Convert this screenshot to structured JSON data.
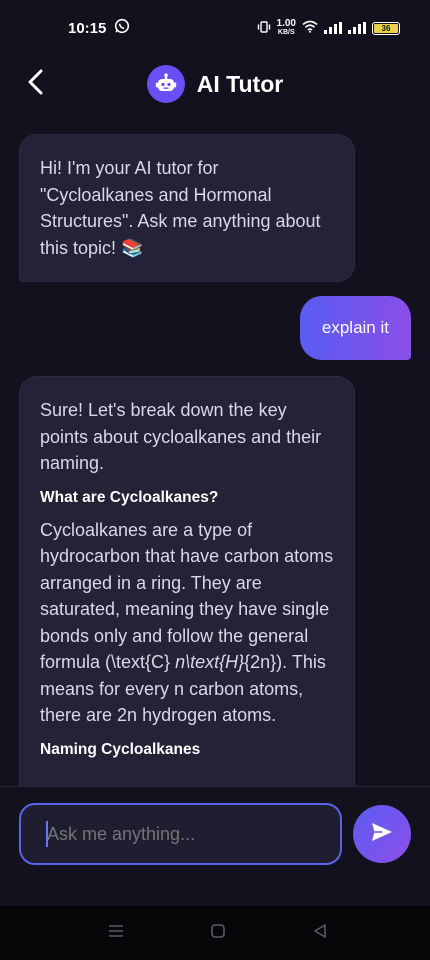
{
  "status_bar": {
    "time": "10:15",
    "net_speed_value": "1.00",
    "net_speed_unit": "KB/S",
    "battery_level": "36"
  },
  "header": {
    "title": "AI Tutor"
  },
  "messages": {
    "greeting": "Hi! I'm your AI tutor for \"Cycloalkanes and Hormonal Structures\". Ask me anything about this topic! 📚",
    "user_message": "explain it",
    "reply": {
      "intro": "Sure! Let's break down the key points about cycloalkanes and their naming.",
      "heading_1": "What are Cycloalkanes?",
      "para_1_a": "Cycloalkanes are a type of hydrocarbon that have carbon atoms arranged in a ring. They are saturated, meaning they have single bonds only and follow the general formula (\\text{C}",
      "para_1_b": "n\\text{H}",
      "para_1_c": "{2n}). This means for every n carbon atoms, there are 2n hydrogen atoms.",
      "heading_2": "Naming Cycloalkanes"
    }
  },
  "input": {
    "placeholder": "Ask me anything..."
  },
  "colors": {
    "background": "#12111d",
    "accent": "#6c4ef6",
    "ai_bubble": "#232236",
    "input_border": "#5b63e8"
  },
  "icons": {
    "back": "back-arrow-icon",
    "bot": "robot-icon",
    "send": "send-icon",
    "whatsapp": "whatsapp-icon",
    "vibrate": "vibrate-icon",
    "wifi": "wifi-icon",
    "signal": "signal-icon",
    "battery": "battery-icon",
    "nav_recents": "recents-icon",
    "nav_home": "home-icon",
    "nav_back": "nav-back-icon"
  }
}
